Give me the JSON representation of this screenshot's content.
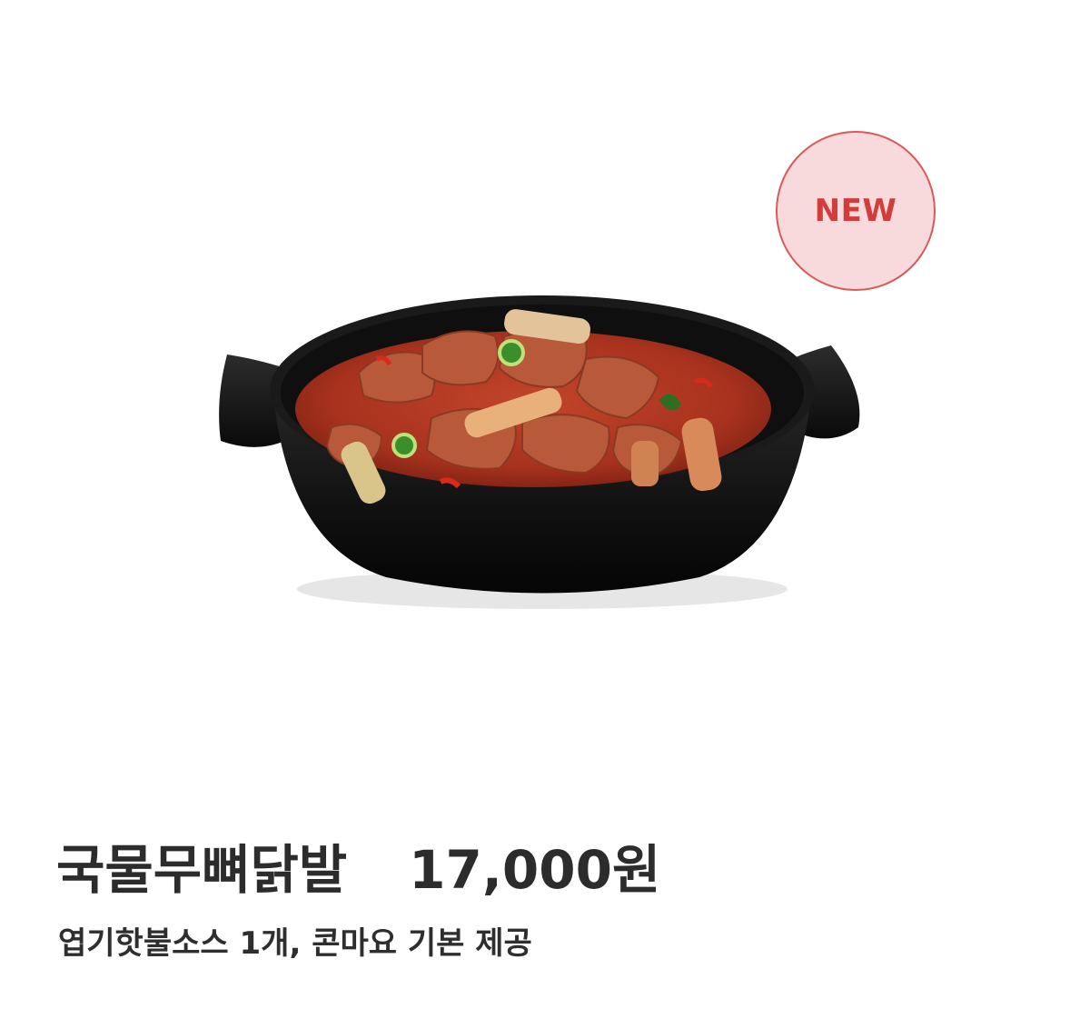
{
  "product": {
    "badge": "NEW",
    "name": "국물무뼈닭발",
    "price": "17,000원",
    "description": "엽기핫불소스 1개, 콘마요 기본 제공",
    "image_alt": "국물무뼈닭발"
  },
  "colors": {
    "badge_bg": "#f8d9dc",
    "badge_border": "#d95a5a",
    "badge_text": "#d43c3c",
    "text": "#2c2c2c",
    "pot": "#121212",
    "sauce": "#a8321e"
  }
}
